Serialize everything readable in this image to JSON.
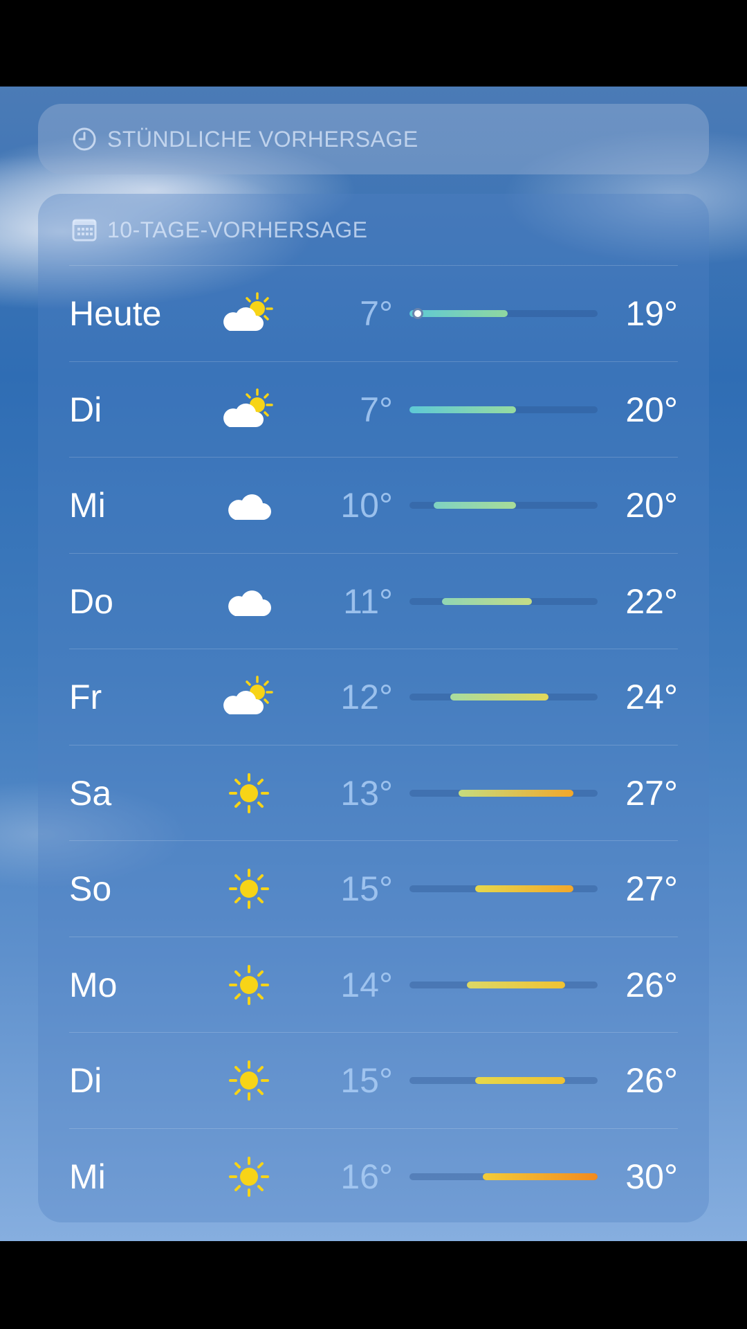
{
  "hourly": {
    "title": "STÜNDLICHE VORHERSAGE",
    "icon": "clock-icon"
  },
  "daily": {
    "title": "10-TAGE-VORHERSAGE",
    "icon": "calendar-icon",
    "range_min": 7,
    "range_max": 30,
    "days": [
      {
        "day": "Heute",
        "icon": "partly-sunny-icon",
        "low": "7°",
        "high": "19°",
        "low_val": 7,
        "high_val": 19,
        "current_val": 8,
        "color_from": "#5ec9d6",
        "color_to": "#8fd7a0"
      },
      {
        "day": "Di",
        "icon": "partly-sunny-icon",
        "low": "7°",
        "high": "20°",
        "low_val": 7,
        "high_val": 20,
        "color_from": "#5ec9d6",
        "color_to": "#97dba0"
      },
      {
        "day": "Mi",
        "icon": "cloud-icon",
        "low": "10°",
        "high": "20°",
        "low_val": 10,
        "high_val": 20,
        "color_from": "#7fd2c2",
        "color_to": "#a8dc98"
      },
      {
        "day": "Do",
        "icon": "cloud-icon",
        "low": "11°",
        "high": "22°",
        "low_val": 11,
        "high_val": 22,
        "color_from": "#90d6b4",
        "color_to": "#c4dc86"
      },
      {
        "day": "Fr",
        "icon": "partly-sunny-icon",
        "low": "12°",
        "high": "24°",
        "low_val": 12,
        "high_val": 24,
        "color_from": "#a8dca0",
        "color_to": "#e2d85a"
      },
      {
        "day": "Sa",
        "icon": "sun-icon",
        "low": "13°",
        "high": "27°",
        "low_val": 13,
        "high_val": 27,
        "color_from": "#c6dc7e",
        "color_to": "#f2a72a"
      },
      {
        "day": "So",
        "icon": "sun-icon",
        "low": "15°",
        "high": "27°",
        "low_val": 15,
        "high_val": 27,
        "color_from": "#e6d84c",
        "color_to": "#f2a72a"
      },
      {
        "day": "Mo",
        "icon": "sun-icon",
        "low": "14°",
        "high": "26°",
        "low_val": 14,
        "high_val": 26,
        "color_from": "#dcd866",
        "color_to": "#f0c232"
      },
      {
        "day": "Di",
        "icon": "sun-icon",
        "low": "15°",
        "high": "26°",
        "low_val": 15,
        "high_val": 26,
        "color_from": "#e6d84c",
        "color_to": "#f0c232"
      },
      {
        "day": "Mi",
        "icon": "sun-icon",
        "low": "16°",
        "high": "30°",
        "low_val": 16,
        "high_val": 30,
        "color_from": "#f2cc3a",
        "color_to": "#f28a1e"
      }
    ]
  }
}
